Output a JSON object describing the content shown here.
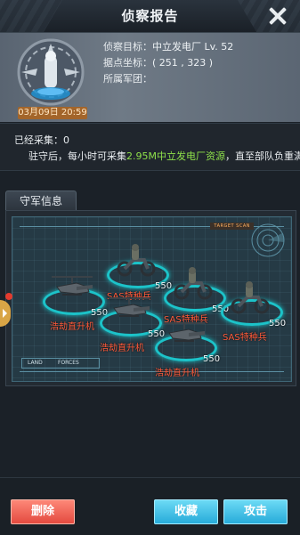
{
  "window": {
    "title": "侦察报告"
  },
  "report": {
    "date": "03月09日 20:59",
    "target_label": "侦察目标：",
    "target_value": "中立发电厂 Lv. 52",
    "coord_label": "据点坐标：",
    "coord_value": "( 251 , 323 )",
    "legion_label": "所属军团：",
    "legion_value": ""
  },
  "collect": {
    "collected": "已经采集：0",
    "line_prefix": "驻守后，每小时可采集",
    "line_highlight": "2.95M中立发电厂资源",
    "line_suffix": "，直至部队负重满"
  },
  "section": {
    "tab_label": "守军信息"
  },
  "map": {
    "target_tag": "TARGET SCAN",
    "land": "LAND",
    "forces": "FORCES",
    "units": [
      {
        "kind": "helicopter",
        "count": "550",
        "name": "浩劫直升机"
      },
      {
        "kind": "motorbike",
        "count": "550",
        "name": "SAS特种兵"
      },
      {
        "kind": "motorbike",
        "count": "550",
        "name": "SAS特种兵"
      },
      {
        "kind": "helicopter",
        "count": "550",
        "name": "浩劫直升机"
      },
      {
        "kind": "motorbike",
        "count": "550",
        "name": "SAS特种兵"
      },
      {
        "kind": "helicopter",
        "count": "550",
        "name": "浩劫直升机"
      }
    ]
  },
  "buttons": {
    "delete": "删除",
    "collect": "收藏",
    "attack": "攻击"
  },
  "colors": {
    "highlight_green": "#8ee04a",
    "unit_name_red": "#ff5a3a",
    "ring_cyan": "#1cc3c9",
    "date_badge": "#a3652a"
  }
}
